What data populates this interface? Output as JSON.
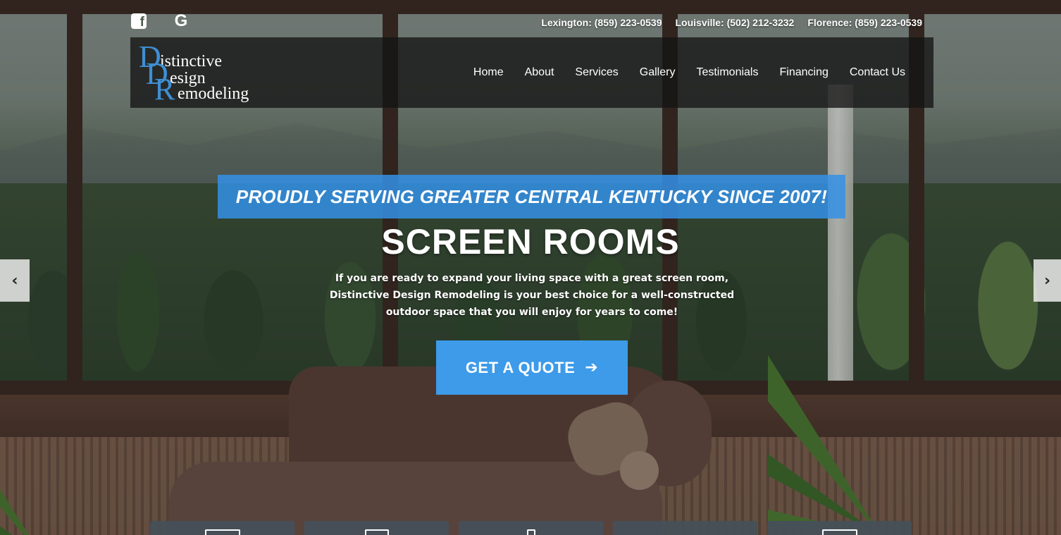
{
  "social": {
    "facebook": "facebook-icon",
    "google": "G"
  },
  "phones": [
    "Lexington: (859) 223-0539",
    "Louisville: (502) 212-3232",
    "Florence: (859) 223-0539"
  ],
  "logo": {
    "d1": "D",
    "line1": "istinctive",
    "d2": "D",
    "line2": "esign",
    "r": "R",
    "line3": "emodeling"
  },
  "nav": [
    "Home",
    "About",
    "Services",
    "Gallery",
    "Testimonials",
    "Financing",
    "Contact Us"
  ],
  "hero": {
    "tagline": "PROUDLY SERVING GREATER CENTRAL KENTUCKY SINCE 2007!",
    "title": "SCREEN ROOMS",
    "description": "If you are ready to expand your living space with a great screen room, Distinctive Design Remodeling is your best choice for a well-constructed outdoor space that you will enjoy for years to come!",
    "cta_label": "GET A QUOTE",
    "cta_icon": "arrow-right-icon"
  },
  "slider": {
    "prev": "‹",
    "next": "›"
  },
  "colors": {
    "accent": "#3d9be9",
    "tagline_bg": "#3491e6",
    "header_bg": "#141414"
  }
}
